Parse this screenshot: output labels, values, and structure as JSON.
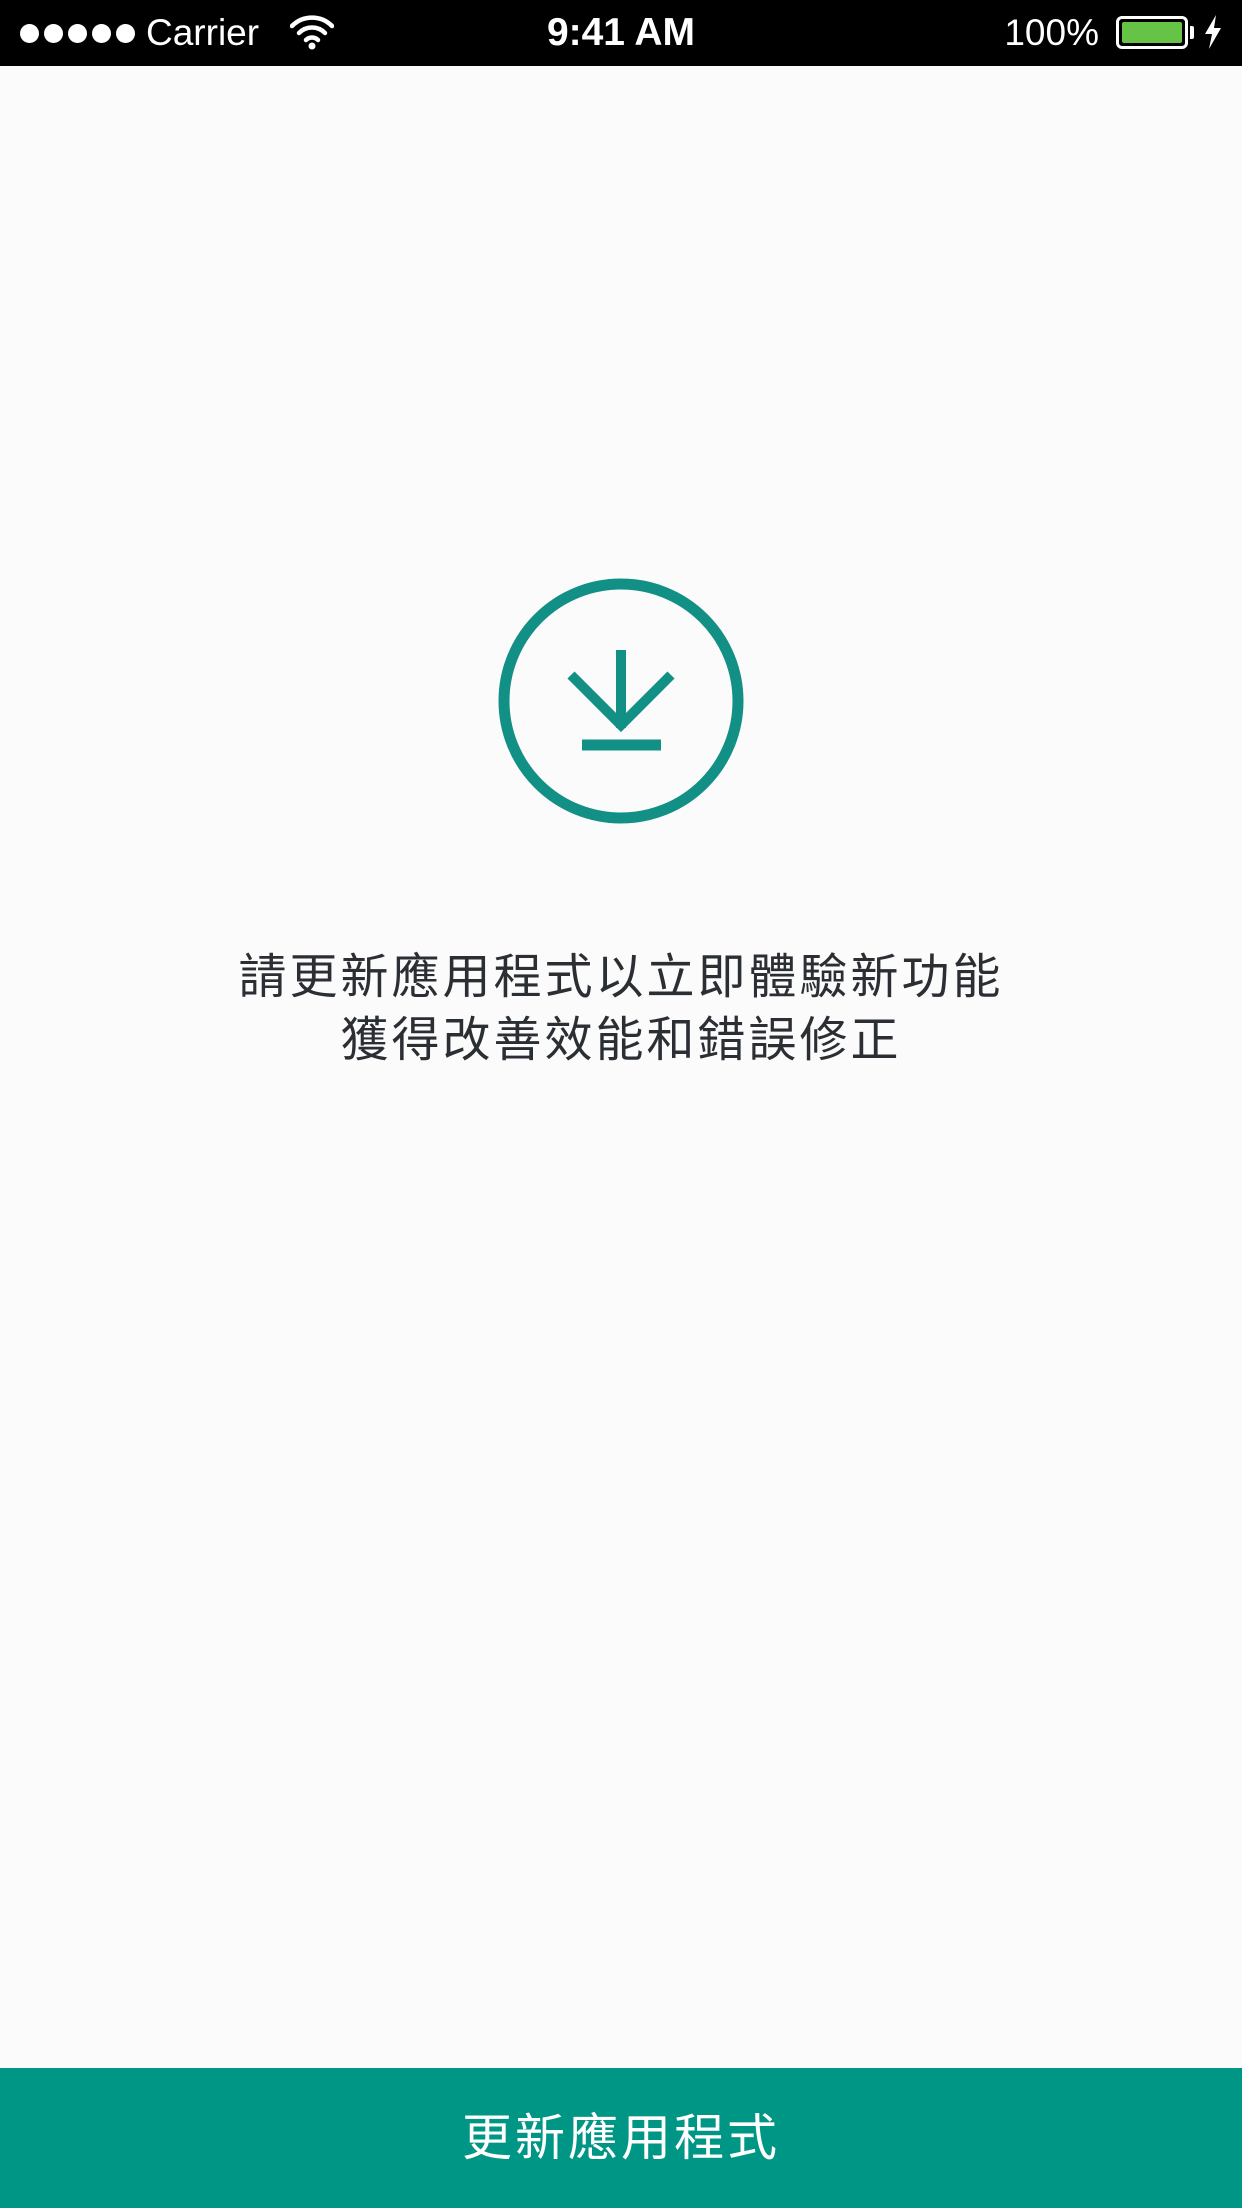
{
  "status_bar": {
    "carrier": "Carrier",
    "time": "9:41 AM",
    "battery_percent": "100%",
    "signal_bars": 5,
    "battery_level": 1.0,
    "battery_color": "#67c345"
  },
  "main": {
    "icon": "download-icon",
    "accent_color": "#129085",
    "message_line1": "請更新應用程式以立即體驗新功能",
    "message_line2": "獲得改善效能和錯誤修正"
  },
  "footer": {
    "update_button_label": "更新應用程式",
    "button_color": "#009685"
  }
}
